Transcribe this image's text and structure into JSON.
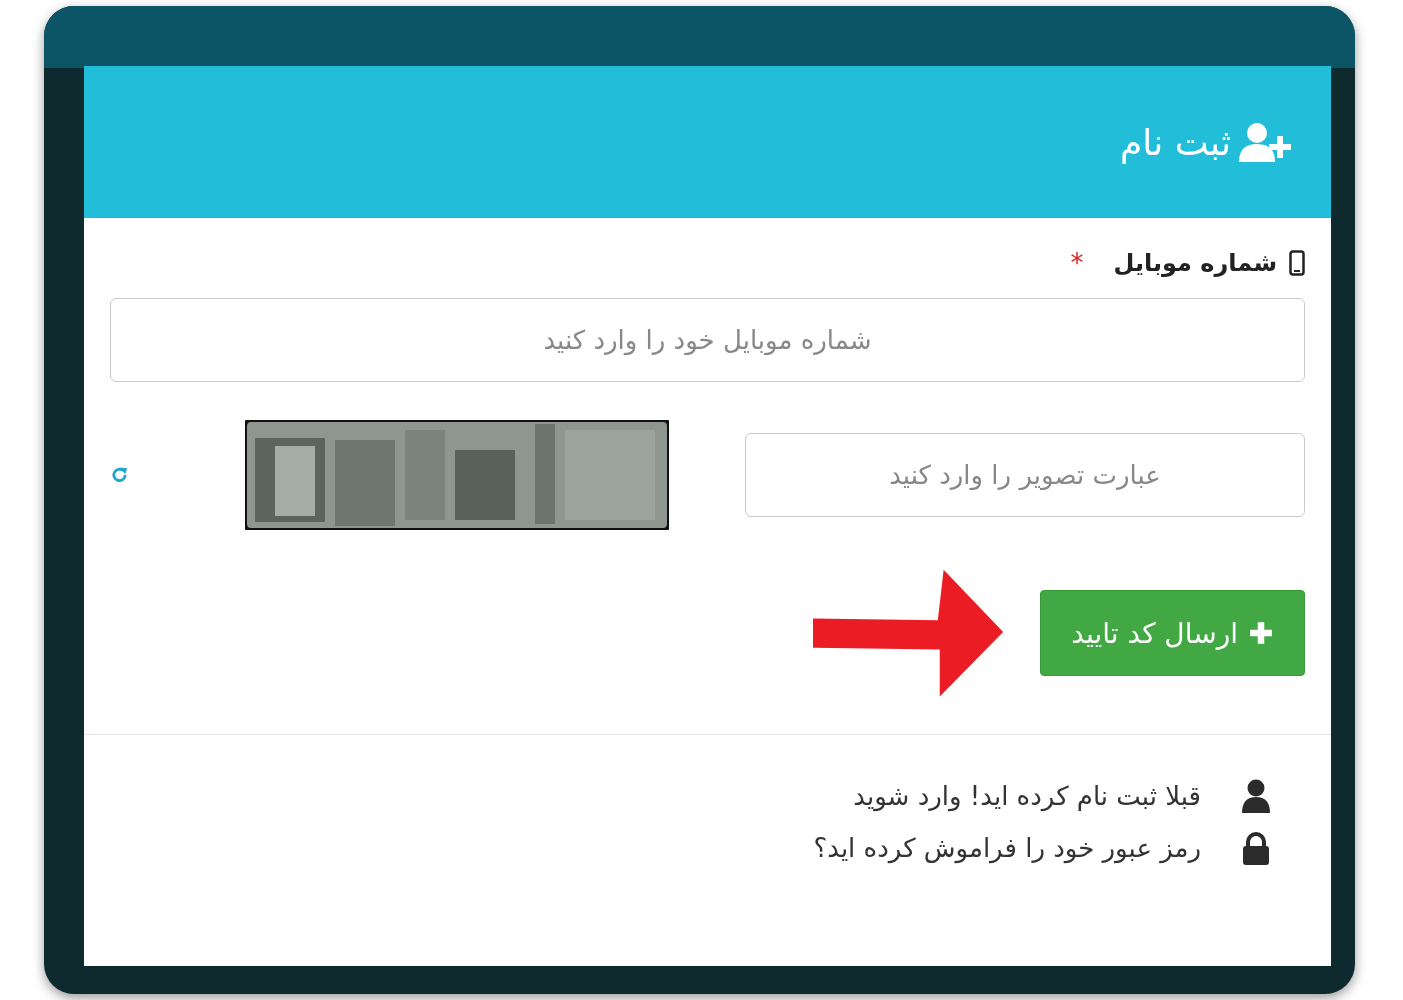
{
  "modal": {
    "title": "ثبت نام",
    "mobile_field": {
      "label": "شماره موبایل",
      "required_mark": "*",
      "placeholder": "شماره موبایل خود را وارد کنید"
    },
    "captcha_field": {
      "placeholder": "عبارت تصویر را وارد کنید"
    },
    "submit_button": {
      "label": "ارسال کد تایید"
    },
    "links": [
      {
        "kind": "login",
        "text": "قبلا ثبت نام کرده اید! وارد شوید"
      },
      {
        "kind": "forgot",
        "text": "رمز عبور خود را فراموش کرده اید؟"
      }
    ]
  }
}
